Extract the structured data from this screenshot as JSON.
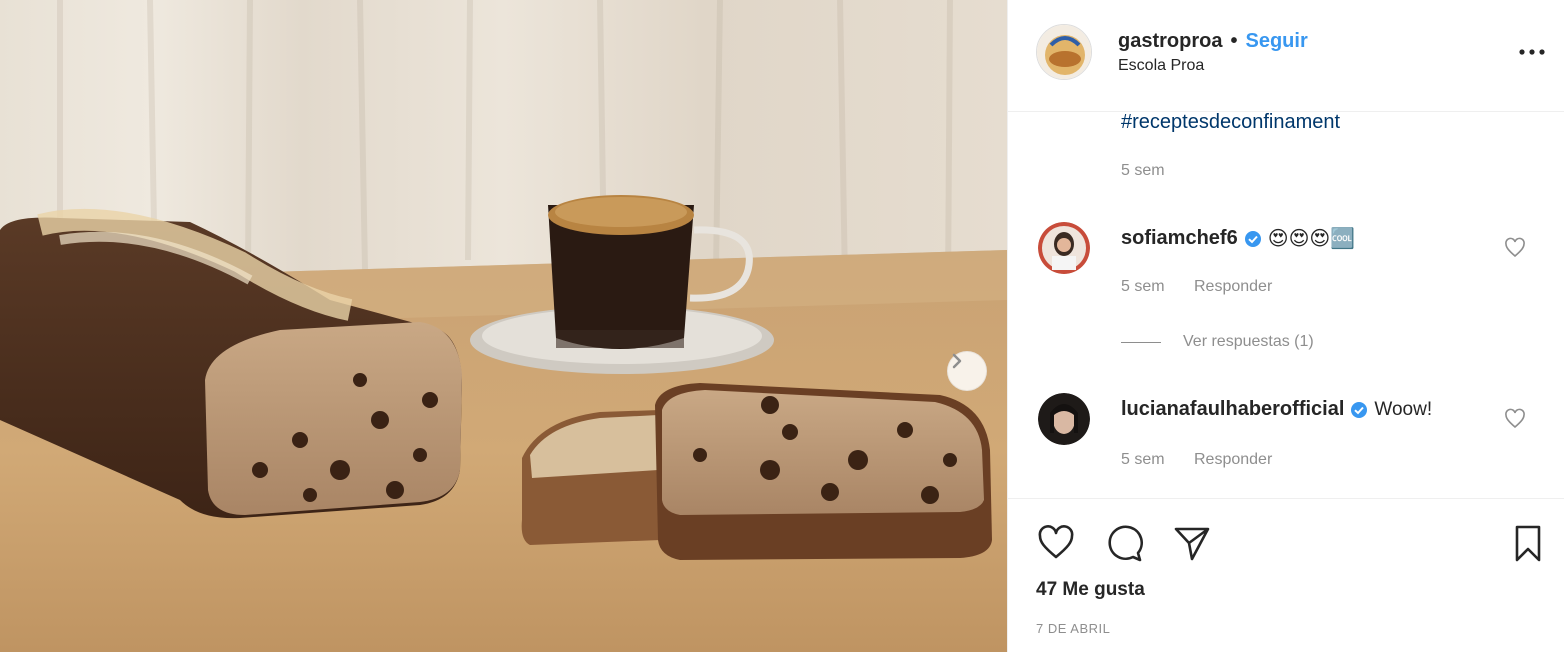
{
  "post": {
    "username": "gastroproa",
    "separator": "•",
    "follow_label": "Seguir",
    "location": "Escola Proa",
    "hashtag": "#receptesdeconfinament",
    "caption_time": "5 sem",
    "likes": "47 Me gusta",
    "date": "7 DE ABRIL"
  },
  "comments": [
    {
      "username": "sofiamchef6",
      "verified": true,
      "text": "😍😍😍🆒",
      "time": "5 sem",
      "reply_label": "Responder",
      "view_replies": "Ver respuestas (1)"
    },
    {
      "username": "lucianafaulhaberofficial",
      "verified": true,
      "text": "Woow!",
      "time": "5 sem",
      "reply_label": "Responder"
    }
  ],
  "colors": {
    "link": "#3897f0",
    "hashtag": "#00376b",
    "muted": "#8e8e8e",
    "text": "#262626",
    "verified": "#3897f0"
  },
  "icons": [
    "more-options-icon",
    "next-arrow-icon",
    "heart-icon",
    "comment-icon",
    "share-icon",
    "bookmark-icon",
    "verified-badge-icon"
  ]
}
